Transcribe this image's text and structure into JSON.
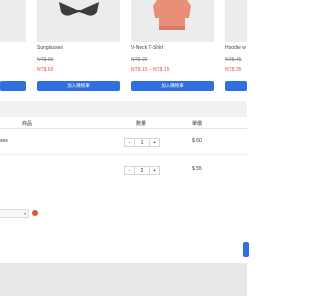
{
  "products": [
    {
      "title": "",
      "price_old": "",
      "price_new": "",
      "button": ""
    },
    {
      "title": "Sunglasses",
      "price_old": "NT$ 90",
      "price_new": "NT$ 60",
      "button": "加入購物車"
    },
    {
      "title": "V-Neck T-Shirt",
      "price_old": "NT$ 20",
      "price_new": "NT$ 10 – NT$ 15",
      "button": "加入購物車"
    },
    {
      "title": "Hoodie w",
      "price_old": "NT$ 45",
      "price_new": "NT$ 35",
      "button": ""
    }
  ],
  "cart": {
    "headers": {
      "product": "商品",
      "quantity": "數量",
      "unit_price": "單價"
    },
    "rows": [
      {
        "name": "ses",
        "qty": "1",
        "price": "$ 60"
      },
      {
        "name": "",
        "qty": "2",
        "price": "$ 55"
      }
    ],
    "minus": "-",
    "plus": "+"
  },
  "select": {
    "arrow": "▾"
  },
  "colors": {
    "accent": "#2f6fe0",
    "sale": "#e0533f"
  }
}
